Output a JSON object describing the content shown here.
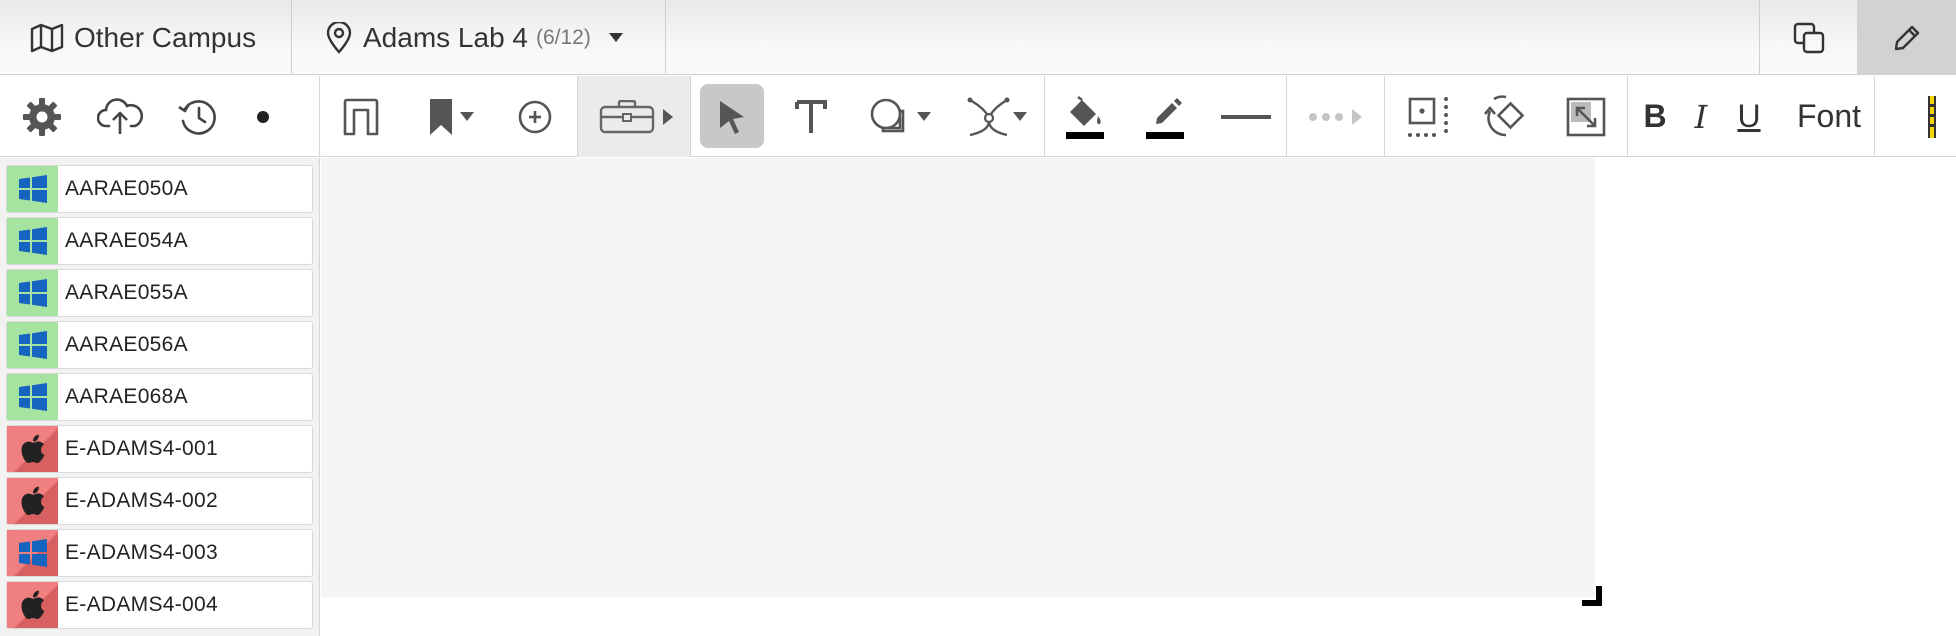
{
  "header": {
    "campus": "Other Campus",
    "lab_name": "Adams Lab 4",
    "lab_count": "(6/12)"
  },
  "toolbar": {
    "bold": "B",
    "italic": "I",
    "underline": "U",
    "font": "Font"
  },
  "machines": [
    {
      "name": "AARAE050A",
      "os": "windows",
      "status": "available"
    },
    {
      "name": "AARAE054A",
      "os": "windows",
      "status": "available"
    },
    {
      "name": "AARAE055A",
      "os": "windows",
      "status": "available"
    },
    {
      "name": "AARAE056A",
      "os": "windows",
      "status": "available"
    },
    {
      "name": "AARAE068A",
      "os": "windows",
      "status": "available"
    },
    {
      "name": "E-ADAMS4-001",
      "os": "apple",
      "status": "in-use"
    },
    {
      "name": "E-ADAMS4-002",
      "os": "apple",
      "status": "in-use"
    },
    {
      "name": "E-ADAMS4-003",
      "os": "windows",
      "status": "in-use"
    },
    {
      "name": "E-ADAMS4-004",
      "os": "apple",
      "status": "in-use"
    }
  ],
  "colors": {
    "available": "#a5e3a0",
    "in_use": "#f07f7f",
    "windows_blue": "#1565c0",
    "accent_yellow": "#f2d600"
  }
}
